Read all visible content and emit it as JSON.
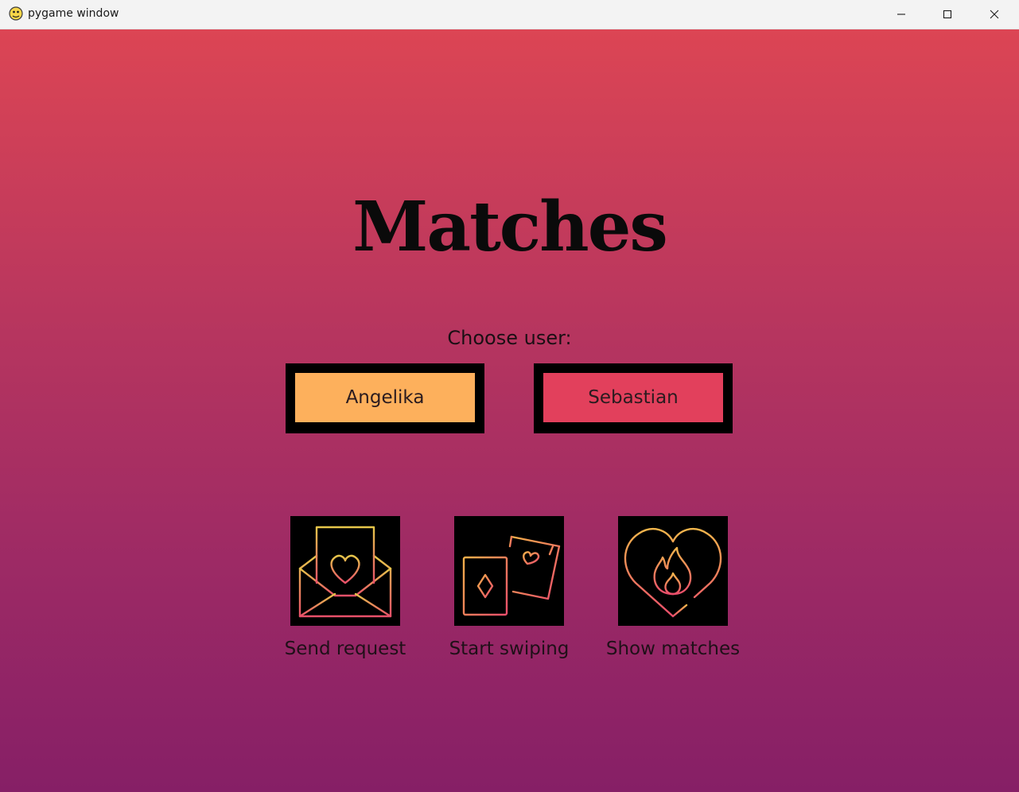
{
  "window": {
    "title": "pygame window",
    "controls": [
      "minimize-icon",
      "maximize-icon",
      "close-icon"
    ]
  },
  "screen": {
    "heading": "Matches",
    "choose_label": "Choose user:",
    "users": [
      {
        "label": "Angelika",
        "color": "#fdb05c"
      },
      {
        "label": "Sebastian",
        "color": "#e2405c"
      }
    ],
    "actions": [
      {
        "label": "Send request",
        "icon": "envelope-heart-icon"
      },
      {
        "label": "Start swiping",
        "icon": "cards-swipe-icon"
      },
      {
        "label": "Show matches",
        "icon": "heart-flame-icon"
      }
    ]
  },
  "colors": {
    "gradient_top": "#dc4554",
    "gradient_bottom": "#861f66",
    "icon_gradient_start": "#f6a54e",
    "icon_gradient_end": "#ec4f6c"
  }
}
